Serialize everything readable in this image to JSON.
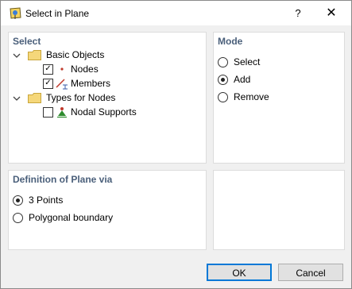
{
  "window": {
    "title": "Select in Plane",
    "help_label": "?",
    "close_label": "✕"
  },
  "select_panel": {
    "title": "Select",
    "tree": [
      {
        "label": "Basic Objects",
        "expanded": true,
        "icon": "folder-icon"
      },
      {
        "label": "Nodes",
        "checked": true,
        "icon": "node-icon"
      },
      {
        "label": "Members",
        "checked": true,
        "icon": "member-icon"
      },
      {
        "label": "Types for Nodes",
        "expanded": true,
        "icon": "folder-icon"
      },
      {
        "label": "Nodal Supports",
        "checked": false,
        "icon": "nodal-support-icon"
      }
    ]
  },
  "mode_panel": {
    "title": "Mode",
    "options": [
      {
        "label": "Select",
        "selected": false
      },
      {
        "label": "Add",
        "selected": true
      },
      {
        "label": "Remove",
        "selected": false
      }
    ]
  },
  "plane_panel": {
    "title": "Definition of Plane via",
    "options": [
      {
        "label": "3 Points",
        "selected": true
      },
      {
        "label": "Polygonal boundary",
        "selected": false
      }
    ]
  },
  "buttons": {
    "ok": "OK",
    "cancel": "Cancel"
  },
  "colors": {
    "panel_title": "#4a5f7a",
    "folder": "#f5d77a",
    "node": "#c0392b",
    "support": "#2e8b2e",
    "default_button_border": "#0078d7"
  }
}
